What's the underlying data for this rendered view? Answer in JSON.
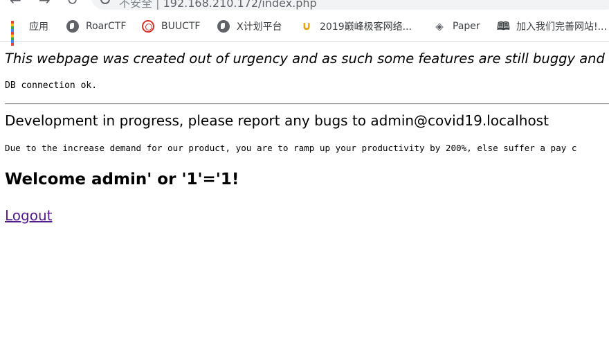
{
  "browser": {
    "address_prefix": "不安全 |",
    "address_url": "192.168.210.172/index.php"
  },
  "bookmarks": [
    {
      "label": "应用",
      "icon": "apps-grid-icon"
    },
    {
      "label": "RoarCTF",
      "icon": "globe-icon"
    },
    {
      "label": "BUUCTF",
      "icon": "buuctf-logo-icon"
    },
    {
      "label": "X计划平台",
      "icon": "globe-icon"
    },
    {
      "label": "2019巅峰极客网络...",
      "icon": "geek-logo-icon"
    },
    {
      "label": "Paper",
      "icon": "layers-icon"
    },
    {
      "label": "加入我们完善网站!...",
      "icon": "book-icon"
    }
  ],
  "page": {
    "notice": "This webpage was created out of urgency and as such some features are still buggy and ma",
    "db_status": "DB connection ok.",
    "dev_message": "Development in progress, please report any bugs to admin@covid19.localhost",
    "memo": "Due to the increase demand for our product, you are to ramp up your productivity by 200%, else suffer a pay c",
    "welcome": "Welcome admin' or '1'='1!",
    "logout_label": "Logout"
  },
  "colors": {
    "link_visited": "#551a8b",
    "bookmark_text": "#3c4043",
    "divider": "#9a9a9a"
  }
}
